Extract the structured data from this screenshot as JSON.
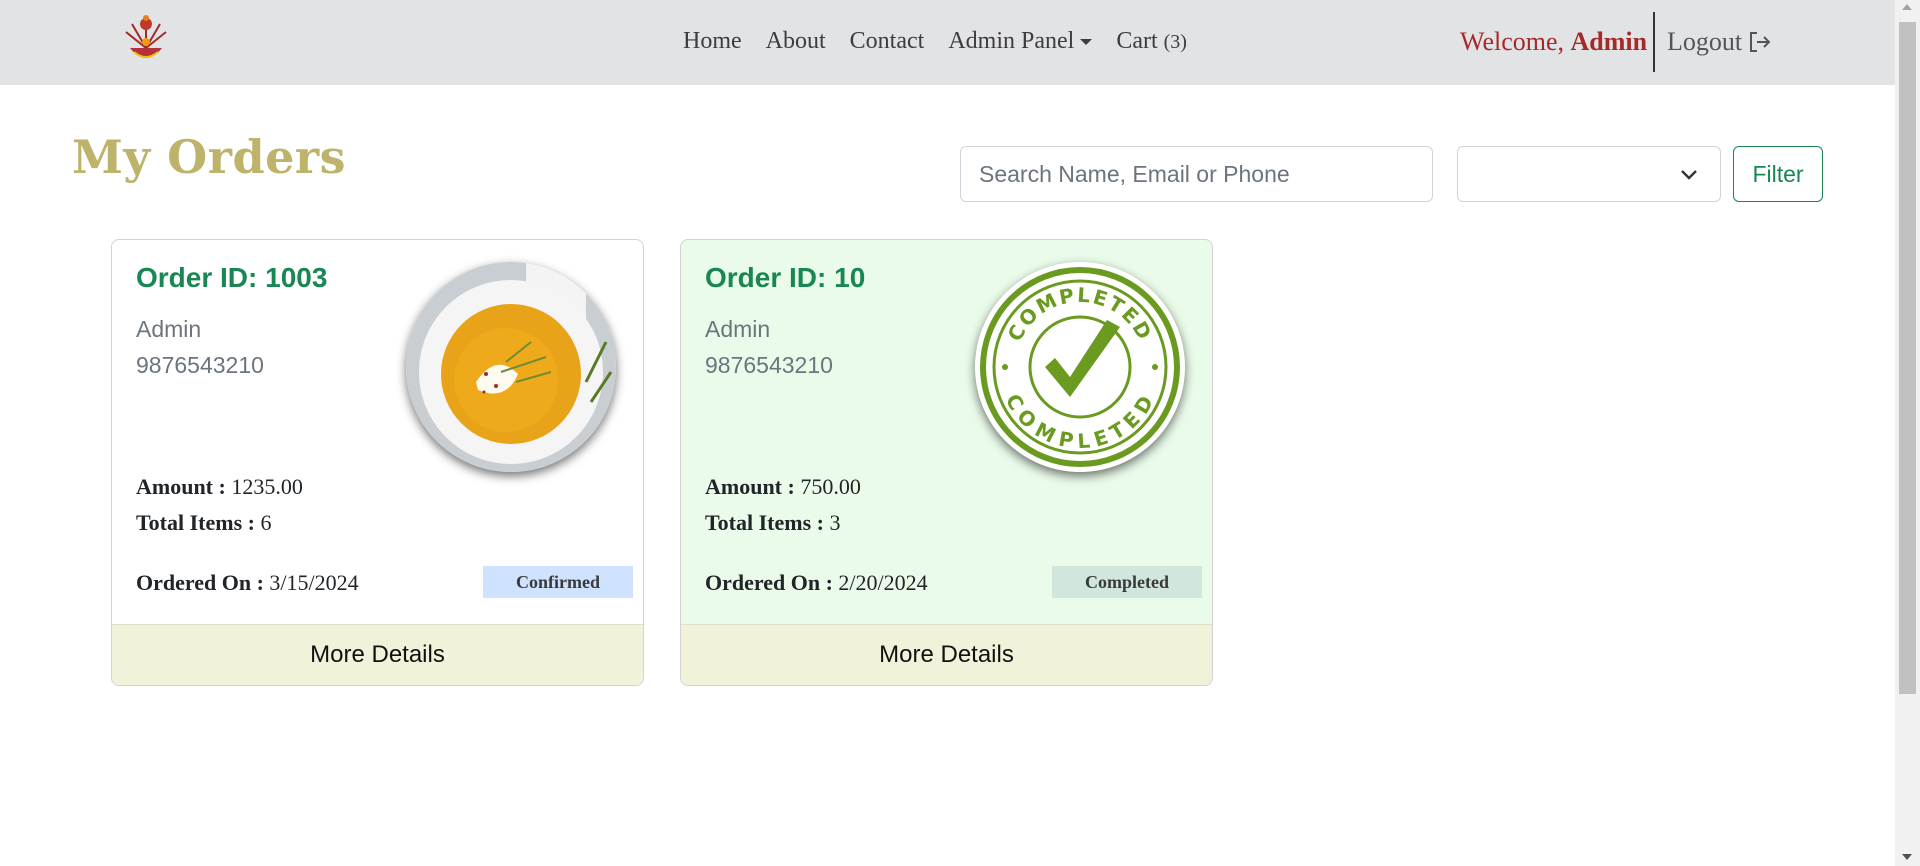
{
  "navbar": {
    "logo_icon": "restaurant-logo-icon",
    "links": [
      {
        "label": "Home"
      },
      {
        "label": "About"
      },
      {
        "label": "Contact"
      },
      {
        "label": "Admin Panel"
      }
    ],
    "cart_label": "Cart",
    "cart_count": "(3)",
    "welcome_prefix": "Welcome,",
    "welcome_user": "Admin",
    "logout_label": "Logout",
    "logout_icon": "logout-icon"
  },
  "page": {
    "title": "My Orders",
    "search_placeholder": "Search Name, Email or Phone",
    "status_select_value": "",
    "filter_label": "Filter"
  },
  "orders": [
    {
      "order_id_label": "Order ID: 1003",
      "customer": "Admin",
      "phone": "9876543210",
      "amount_label": "Amount :",
      "amount": "1235.00",
      "items_label": "Total Items :",
      "items": "6",
      "ordered_label": "Ordered On :",
      "ordered_on": "3/15/2024",
      "status": "Confirmed",
      "image": "pumpkin-soup-image",
      "details_label": "More Details"
    },
    {
      "order_id_label": "Order ID: 10",
      "customer": "Admin",
      "phone": "9876543210",
      "amount_label": "Amount :",
      "amount": "750.00",
      "items_label": "Total Items :",
      "items": "3",
      "ordered_label": "Ordered On :",
      "ordered_on": "2/20/2024",
      "status": "Completed",
      "image": "completed-stamp-image",
      "stamp_text_top": "COMPLETED",
      "stamp_text_bottom": "COMPLETED",
      "details_label": "More Details"
    }
  ],
  "colors": {
    "navbar_bg": "#e2e3e5",
    "title": "#bdb36a",
    "order_id": "#198754",
    "welcome": "#a52a2a",
    "card_completed_bg": "#eafbea",
    "card_footer_bg": "#f2f2da",
    "badge_confirmed": "#cfe2ff",
    "badge_completed": "#d1e7dd",
    "stamp_green": "#6a9a1f"
  }
}
